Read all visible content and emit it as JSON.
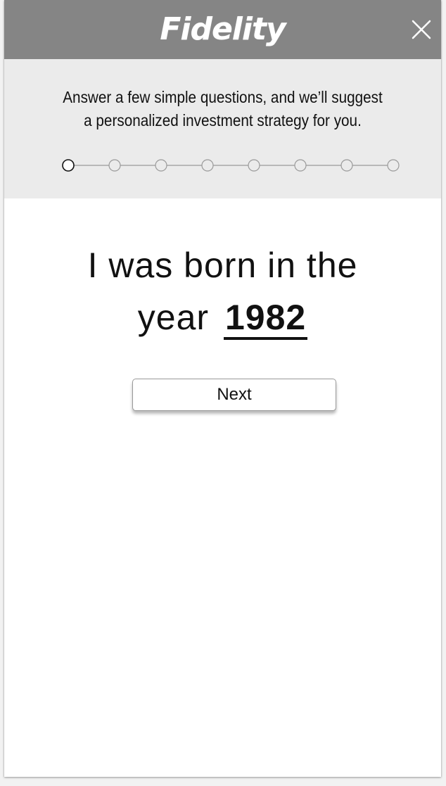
{
  "header": {
    "brand_name": "Fidelity",
    "close_icon": "close-icon",
    "background_color": "#858585"
  },
  "intro": {
    "line1": "Answer a few simple questions, and we’ll suggest",
    "line2": "a personalized investment strategy for you.",
    "background_color": "#ebebeb"
  },
  "progress": {
    "total_steps": 8,
    "current_step": 1
  },
  "question": {
    "line1": "I was born in the",
    "line2_prefix": "year",
    "year_value": "1982"
  },
  "actions": {
    "next_label": "Next"
  }
}
